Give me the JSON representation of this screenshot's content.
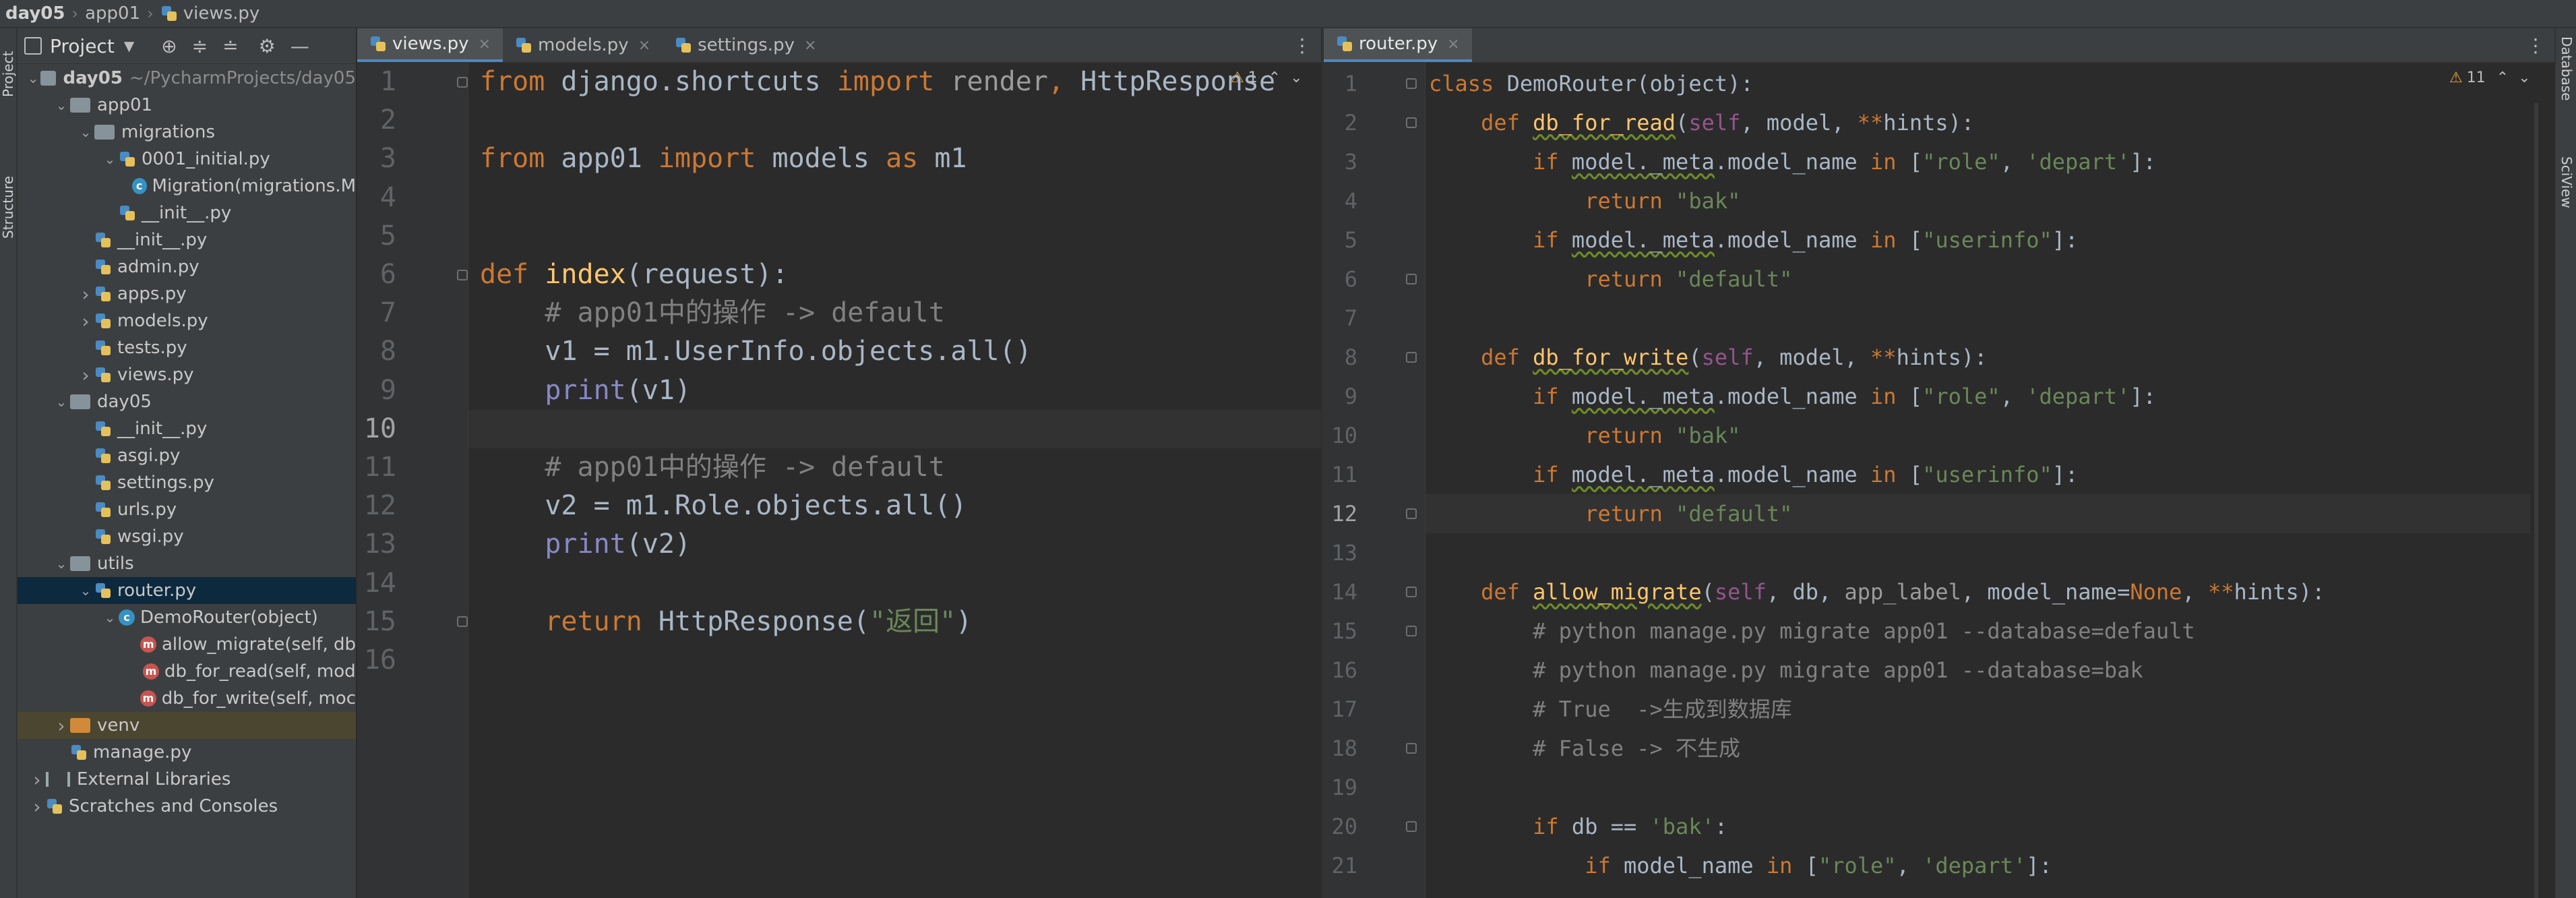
{
  "breadcrumb": [
    "day05",
    "app01",
    "views.py"
  ],
  "left_strip": [
    "Project",
    "Structure"
  ],
  "right_strip": [
    "Database",
    "SciView"
  ],
  "project_panel": {
    "title": "Project",
    "tree": [
      {
        "label": "day05",
        "suffix": "~/PycharmProjects/day05",
        "type": "folder",
        "depth": 0,
        "expanded": true
      },
      {
        "label": "app01",
        "type": "folder",
        "depth": 1,
        "expanded": true
      },
      {
        "label": "migrations",
        "type": "folder",
        "depth": 2,
        "expanded": true
      },
      {
        "label": "0001_initial.py",
        "type": "py",
        "depth": 3,
        "expanded": true
      },
      {
        "label": "Migration(migrations.M",
        "type": "class",
        "depth": 4
      },
      {
        "label": "__init__.py",
        "type": "py",
        "depth": 3
      },
      {
        "label": "__init__.py",
        "type": "py",
        "depth": 2
      },
      {
        "label": "admin.py",
        "type": "py",
        "depth": 2
      },
      {
        "label": "apps.py",
        "type": "py",
        "depth": 2,
        "collapsed": true
      },
      {
        "label": "models.py",
        "type": "py",
        "depth": 2,
        "collapsed": true
      },
      {
        "label": "tests.py",
        "type": "py",
        "depth": 2
      },
      {
        "label": "views.py",
        "type": "py",
        "depth": 2,
        "collapsed": true
      },
      {
        "label": "day05",
        "type": "folder",
        "depth": 1,
        "expanded": true
      },
      {
        "label": "__init__.py",
        "type": "py",
        "depth": 2
      },
      {
        "label": "asgi.py",
        "type": "py",
        "depth": 2
      },
      {
        "label": "settings.py",
        "type": "py",
        "depth": 2
      },
      {
        "label": "urls.py",
        "type": "py",
        "depth": 2
      },
      {
        "label": "wsgi.py",
        "type": "py",
        "depth": 2
      },
      {
        "label": "utils",
        "type": "folder",
        "depth": 1,
        "expanded": true
      },
      {
        "label": "router.py",
        "type": "py",
        "depth": 2,
        "expanded": true,
        "selected": true
      },
      {
        "label": "DemoRouter(object)",
        "type": "class",
        "depth": 3,
        "expanded": true
      },
      {
        "label": "allow_migrate(self, db",
        "type": "method",
        "depth": 4
      },
      {
        "label": "db_for_read(self, mod",
        "type": "method",
        "depth": 4
      },
      {
        "label": "db_for_write(self, moc",
        "type": "method",
        "depth": 4
      },
      {
        "label": "venv",
        "type": "folder-orange",
        "depth": 1,
        "collapsed": true,
        "highlight": true
      },
      {
        "label": "manage.py",
        "type": "py",
        "depth": 1
      },
      {
        "label": "External Libraries",
        "type": "lib",
        "depth": 0,
        "collapsed": true
      },
      {
        "label": "Scratches and Consoles",
        "type": "scratch",
        "depth": 0,
        "collapsed": true
      }
    ]
  },
  "left_editor": {
    "tabs": [
      {
        "label": "views.py",
        "active": true
      },
      {
        "label": "models.py",
        "active": false
      },
      {
        "label": "settings.py",
        "active": false
      }
    ],
    "warning_count": "1",
    "current_line": 10,
    "lines": [
      [
        [
          "kw",
          "from "
        ],
        [
          "",
          "django.shortcuts "
        ],
        [
          "kw",
          "import "
        ],
        [
          "dim",
          "render"
        ],
        [
          "kw",
          ", "
        ],
        [
          "",
          "HttpResponse"
        ]
      ],
      [],
      [
        [
          "kw",
          "from "
        ],
        [
          "",
          "app01 "
        ],
        [
          "kw",
          "import "
        ],
        [
          "",
          "models "
        ],
        [
          "kw",
          "as "
        ],
        [
          "",
          "m1"
        ]
      ],
      [],
      [],
      [
        [
          "kw",
          "def "
        ],
        [
          "fn",
          "index"
        ],
        [
          "",
          "(request):"
        ]
      ],
      [
        [
          "",
          "    "
        ],
        [
          "cm",
          "# app01中的操作 -> default"
        ]
      ],
      [
        [
          "",
          "    v1 = m1.UserInfo.objects.all()"
        ]
      ],
      [
        [
          "",
          "    "
        ],
        [
          "bi",
          "print"
        ],
        [
          "",
          "(v1)"
        ]
      ],
      [],
      [
        [
          "",
          "    "
        ],
        [
          "cm",
          "# app01中的操作 -> default"
        ]
      ],
      [
        [
          "",
          "    v2 = m1.Role.objects.all()"
        ]
      ],
      [
        [
          "",
          "    "
        ],
        [
          "bi",
          "print"
        ],
        [
          "",
          "(v2)"
        ]
      ],
      [],
      [
        [
          "",
          "    "
        ],
        [
          "kw",
          "return "
        ],
        [
          "",
          "HttpResponse("
        ],
        [
          "str",
          "\"返回\""
        ],
        [
          "",
          ")"
        ]
      ],
      []
    ]
  },
  "right_editor": {
    "tabs": [
      {
        "label": "router.py",
        "active": true
      }
    ],
    "warning_count": "11",
    "current_line": 12,
    "lines": [
      [
        [
          "kw",
          "class "
        ],
        [
          "",
          "DemoRouter(object):"
        ]
      ],
      [
        [
          "",
          "    "
        ],
        [
          "kw",
          "def "
        ],
        [
          "fn sq",
          "db_for_read"
        ],
        [
          "",
          "("
        ],
        [
          "self",
          "self"
        ],
        [
          "",
          ", model, "
        ],
        [
          "kw",
          "**"
        ],
        [
          "",
          "hints):"
        ]
      ],
      [
        [
          "",
          "        "
        ],
        [
          "kw",
          "if "
        ],
        [
          "sq",
          "model._meta"
        ],
        [
          "",
          ".model_name "
        ],
        [
          "kw",
          "in "
        ],
        [
          "",
          "["
        ],
        [
          "str",
          "\"role\""
        ],
        [
          "",
          ", "
        ],
        [
          "str",
          "'depart'"
        ],
        [
          "",
          "]:"
        ]
      ],
      [
        [
          "",
          "            "
        ],
        [
          "kw",
          "return "
        ],
        [
          "str",
          "\"bak\""
        ]
      ],
      [
        [
          "",
          "        "
        ],
        [
          "kw",
          "if "
        ],
        [
          "sq",
          "model._meta"
        ],
        [
          "",
          ".model_name "
        ],
        [
          "kw",
          "in "
        ],
        [
          "",
          "["
        ],
        [
          "str",
          "\"userinfo\""
        ],
        [
          "",
          "]:"
        ]
      ],
      [
        [
          "",
          "            "
        ],
        [
          "kw",
          "return "
        ],
        [
          "str",
          "\"default\""
        ]
      ],
      [],
      [
        [
          "",
          "    "
        ],
        [
          "kw",
          "def "
        ],
        [
          "fn sq",
          "db_for_write"
        ],
        [
          "",
          "("
        ],
        [
          "self",
          "self"
        ],
        [
          "",
          ", model, "
        ],
        [
          "kw",
          "**"
        ],
        [
          "",
          "hints):"
        ]
      ],
      [
        [
          "",
          "        "
        ],
        [
          "kw",
          "if "
        ],
        [
          "sq",
          "model._meta"
        ],
        [
          "",
          ".model_name "
        ],
        [
          "kw",
          "in "
        ],
        [
          "",
          "["
        ],
        [
          "str",
          "\"role\""
        ],
        [
          "",
          ", "
        ],
        [
          "str",
          "'depart'"
        ],
        [
          "",
          "]:"
        ]
      ],
      [
        [
          "",
          "            "
        ],
        [
          "kw",
          "return "
        ],
        [
          "str",
          "\"bak\""
        ]
      ],
      [
        [
          "",
          "        "
        ],
        [
          "kw",
          "if "
        ],
        [
          "sq",
          "model._meta"
        ],
        [
          "",
          ".model_name "
        ],
        [
          "kw",
          "in "
        ],
        [
          "",
          "["
        ],
        [
          "str",
          "\"userinfo\""
        ],
        [
          "",
          "]:"
        ]
      ],
      [
        [
          "",
          "            "
        ],
        [
          "kw",
          "return "
        ],
        [
          "str",
          "\"default\""
        ]
      ],
      [],
      [
        [
          "",
          "    "
        ],
        [
          "kw",
          "def "
        ],
        [
          "fn sq",
          "allow_migrate"
        ],
        [
          "",
          "("
        ],
        [
          "self",
          "self"
        ],
        [
          "",
          ", db, "
        ],
        [
          "dim",
          "app_label"
        ],
        [
          "",
          ", model_name="
        ],
        [
          "kw",
          "None"
        ],
        [
          "",
          ", "
        ],
        [
          "kw",
          "**"
        ],
        [
          "",
          "hints):"
        ]
      ],
      [
        [
          "",
          "        "
        ],
        [
          "cm",
          "# python manage.py migrate app01 --database=default"
        ]
      ],
      [
        [
          "",
          "        "
        ],
        [
          "cm",
          "# python manage.py migrate app01 --database=bak"
        ]
      ],
      [
        [
          "",
          "        "
        ],
        [
          "cm",
          "# True  ->生成到数据库"
        ]
      ],
      [
        [
          "",
          "        "
        ],
        [
          "cm",
          "# False -> 不生成"
        ]
      ],
      [],
      [
        [
          "",
          "        "
        ],
        [
          "kw",
          "if "
        ],
        [
          "",
          "db == "
        ],
        [
          "str",
          "'bak'"
        ],
        [
          "",
          ":"
        ]
      ],
      [
        [
          "",
          "            "
        ],
        [
          "kw",
          "if "
        ],
        [
          "",
          "model_name "
        ],
        [
          "kw",
          "in "
        ],
        [
          "",
          "["
        ],
        [
          "str",
          "\"role\""
        ],
        [
          "",
          ", "
        ],
        [
          "str",
          "'depart'"
        ],
        [
          "",
          "]:"
        ]
      ]
    ]
  }
}
